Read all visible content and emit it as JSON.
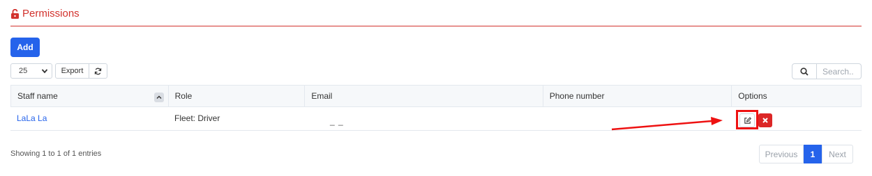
{
  "header": {
    "title": "Permissions",
    "icon": "lock-open-icon",
    "accent": "#d2322d"
  },
  "toolbar": {
    "add_label": "Add",
    "page_size": "25",
    "export_label": "Export",
    "search_placeholder": "Search.."
  },
  "table": {
    "columns": [
      "Staff name",
      "Role",
      "Email",
      "Phone number",
      "Options"
    ],
    "rows": [
      {
        "staff_name": "LaLa La",
        "role": "Fleet: Driver",
        "email": "_ _",
        "phone": ""
      }
    ]
  },
  "footer": {
    "showing": "Showing 1 to 1 of 1 entries",
    "prev": "Previous",
    "current_page": "1",
    "next": "Next"
  },
  "colors": {
    "primary": "#2563eb",
    "danger": "#dc2626",
    "annotation": "#e11111"
  }
}
